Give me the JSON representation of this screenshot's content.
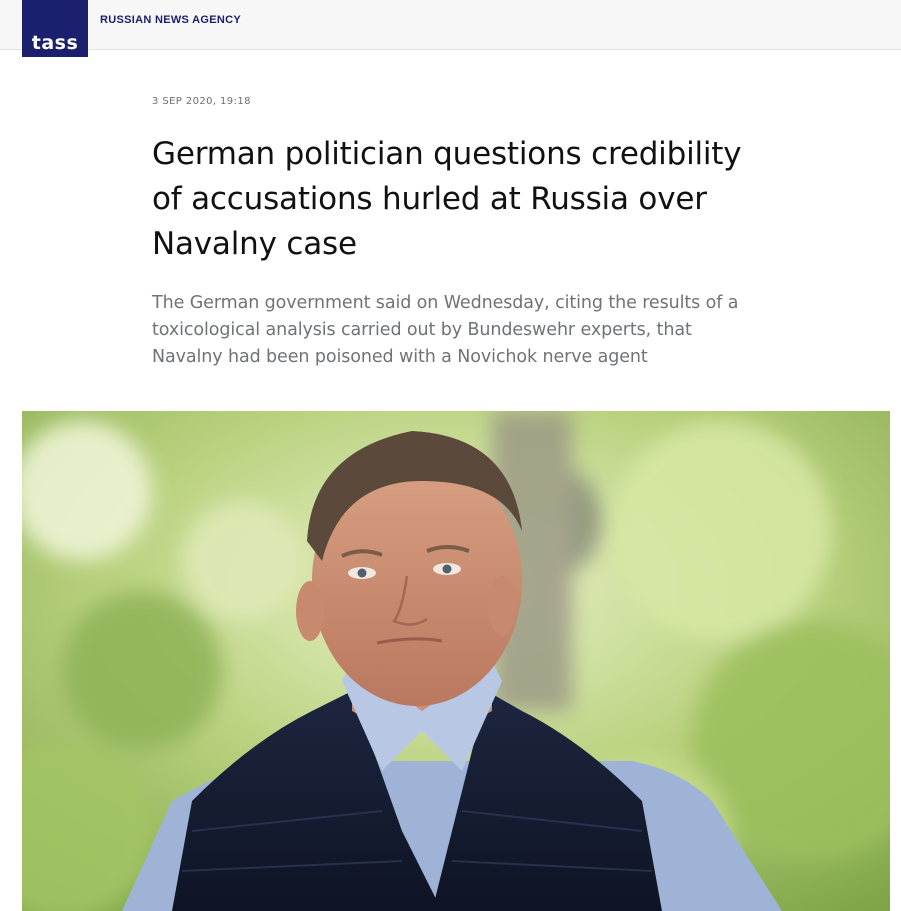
{
  "header": {
    "logo_text": "TASS",
    "agency_name": "RUSSIAN NEWS AGENCY",
    "brand_color": "#1a1f6e"
  },
  "article": {
    "date": "3 SEP 2020, 19:18",
    "headline": "German politician questions credibility of accusations hurled at Russia over Navalny case",
    "lead": "The German government said on Wednesday, citing the results of a toxicological analysis carried out by Bundeswehr experts, that Navalny had been poisoned with a Novichok nerve agent"
  }
}
